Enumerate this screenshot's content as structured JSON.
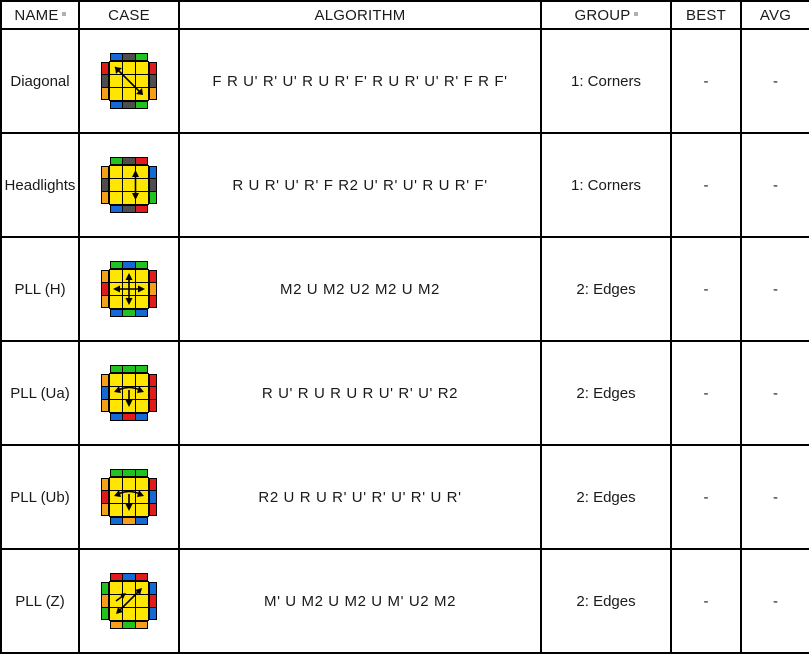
{
  "table": {
    "headers": [
      {
        "key": "name",
        "label": "NAME",
        "mark": true
      },
      {
        "key": "case",
        "label": "CASE",
        "mark": false
      },
      {
        "key": "alg",
        "label": "ALGORITHM",
        "mark": false
      },
      {
        "key": "group",
        "label": "GROUP",
        "mark": true
      },
      {
        "key": "best",
        "label": "BEST",
        "mark": false
      },
      {
        "key": "avg",
        "label": "AVG",
        "mark": false
      }
    ],
    "rows": [
      {
        "name": "Diagonal",
        "algorithm": "F R U' R' U' R U R' F' R U R' U' R' F R F'",
        "group": "1: Corners",
        "best": "-",
        "avg": "-",
        "case": {
          "top": [
            "#1569d4",
            "#4d4d4d",
            "#1fc21f"
          ],
          "right": [
            "#e01b1b",
            "#4d4d4d",
            "#f5a01b"
          ],
          "bottom": [
            "#1569d4",
            "#4d4d4d",
            "#1fc21f"
          ],
          "left": [
            "#e01b1b",
            "#4d4d4d",
            "#f5a01b"
          ],
          "arrows": "diagonal-corners"
        }
      },
      {
        "name": "Headlights",
        "algorithm": "R U R' U' R' F R2 U' R' U' R U R' F'",
        "group": "1: Corners",
        "best": "-",
        "avg": "-",
        "case": {
          "top": [
            "#1fc21f",
            "#4d4d4d",
            "#e01b1b"
          ],
          "right": [
            "#1569d4",
            "#4d4d4d",
            "#1fc21f"
          ],
          "bottom": [
            "#1569d4",
            "#4d4d4d",
            "#e01b1b"
          ],
          "left": [
            "#f5a01b",
            "#4d4d4d",
            "#f5a01b"
          ],
          "arrows": "right-swap-vertical"
        }
      },
      {
        "name": "PLL (H)",
        "algorithm": "M2 U M2 U2 M2 U M2",
        "group": "2: Edges",
        "best": "-",
        "avg": "-",
        "case": {
          "top": [
            "#1fc21f",
            "#1569d4",
            "#1fc21f"
          ],
          "right": [
            "#e01b1b",
            "#f5a01b",
            "#e01b1b"
          ],
          "bottom": [
            "#1569d4",
            "#1fc21f",
            "#1569d4"
          ],
          "left": [
            "#f5a01b",
            "#e01b1b",
            "#f5a01b"
          ],
          "arrows": "h-perm"
        }
      },
      {
        "name": "PLL (Ua)",
        "algorithm": "R U' R U R U R U' R' U' R2",
        "group": "2: Edges",
        "best": "-",
        "avg": "-",
        "case": {
          "top": [
            "#1fc21f",
            "#1fc21f",
            "#1fc21f"
          ],
          "right": [
            "#e01b1b",
            "#e01b1b",
            "#e01b1b"
          ],
          "bottom": [
            "#1569d4",
            "#e01b1b",
            "#1569d4"
          ],
          "left": [
            "#f5a01b",
            "#1569d4",
            "#f5a01b"
          ],
          "arrows": "u-perm-ccw"
        }
      },
      {
        "name": "PLL (Ub)",
        "algorithm": "R2 U R U R' U' R' U' R' U R'",
        "group": "2: Edges",
        "best": "-",
        "avg": "-",
        "case": {
          "top": [
            "#1fc21f",
            "#1fc21f",
            "#1fc21f"
          ],
          "right": [
            "#e01b1b",
            "#1569d4",
            "#e01b1b"
          ],
          "bottom": [
            "#1569d4",
            "#f5a01b",
            "#1569d4"
          ],
          "left": [
            "#f5a01b",
            "#e01b1b",
            "#f5a01b"
          ],
          "arrows": "u-perm-cw"
        }
      },
      {
        "name": "PLL (Z)",
        "algorithm": "M' U M2 U M2 U M' U2 M2",
        "group": "2: Edges",
        "best": "-",
        "avg": "-",
        "case": {
          "top": [
            "#e01b1b",
            "#1569d4",
            "#e01b1b"
          ],
          "right": [
            "#1569d4",
            "#e01b1b",
            "#1569d4"
          ],
          "bottom": [
            "#f5a01b",
            "#1fc21f",
            "#f5a01b"
          ],
          "left": [
            "#1fc21f",
            "#f5a01b",
            "#1fc21f"
          ],
          "arrows": "z-perm"
        }
      }
    ]
  },
  "colors": {
    "top_face": "#ffe600",
    "grid_line": "#000000",
    "border": "#000000",
    "text": "#1a1a1a"
  }
}
